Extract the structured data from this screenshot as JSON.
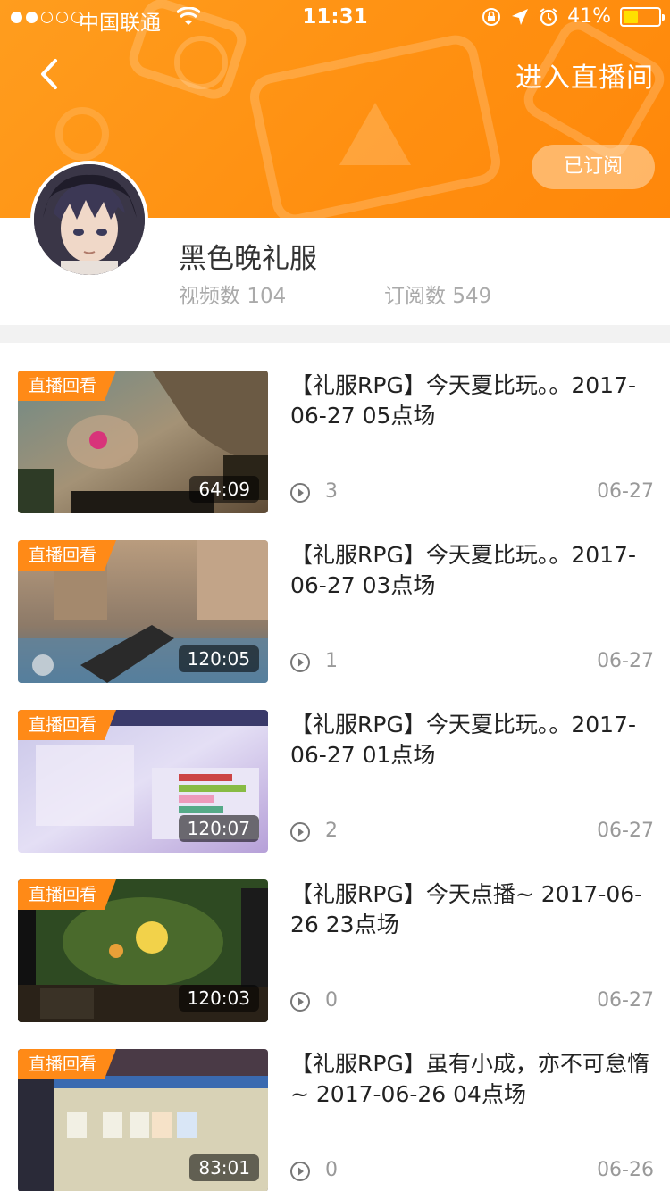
{
  "status_bar": {
    "carrier": "中国联通",
    "time": "11:31",
    "battery": "41%",
    "battery_level": 0.41
  },
  "header": {
    "enter_live_room": "进入直播间",
    "subscribed_label": "已订阅",
    "accent_color": "#ff8f10"
  },
  "profile": {
    "name": "黑色晚礼服",
    "videos_label": "视频数",
    "videos_count": "104",
    "subs_label": "订阅数",
    "subs_count": "549"
  },
  "videos": [
    {
      "badge": "直播回看",
      "duration": "64:09",
      "title": "【礼服RPG】今天夏比玩。。2017-06-27 05点场",
      "plays": "3",
      "date": "06-27"
    },
    {
      "badge": "直播回看",
      "duration": "120:05",
      "title": "【礼服RPG】今天夏比玩。。2017-06-27 03点场",
      "plays": "1",
      "date": "06-27"
    },
    {
      "badge": "直播回看",
      "duration": "120:07",
      "title": "【礼服RPG】今天夏比玩。。2017-06-27 01点场",
      "plays": "2",
      "date": "06-27"
    },
    {
      "badge": "直播回看",
      "duration": "120:03",
      "title": "【礼服RPG】今天点播~ 2017-06-26 23点场",
      "plays": "0",
      "date": "06-27"
    },
    {
      "badge": "直播回看",
      "duration": "83:01",
      "title": "【礼服RPG】虽有小成，亦不可怠惰~ 2017-06-26 04点场",
      "plays": "0",
      "date": "06-26"
    }
  ]
}
